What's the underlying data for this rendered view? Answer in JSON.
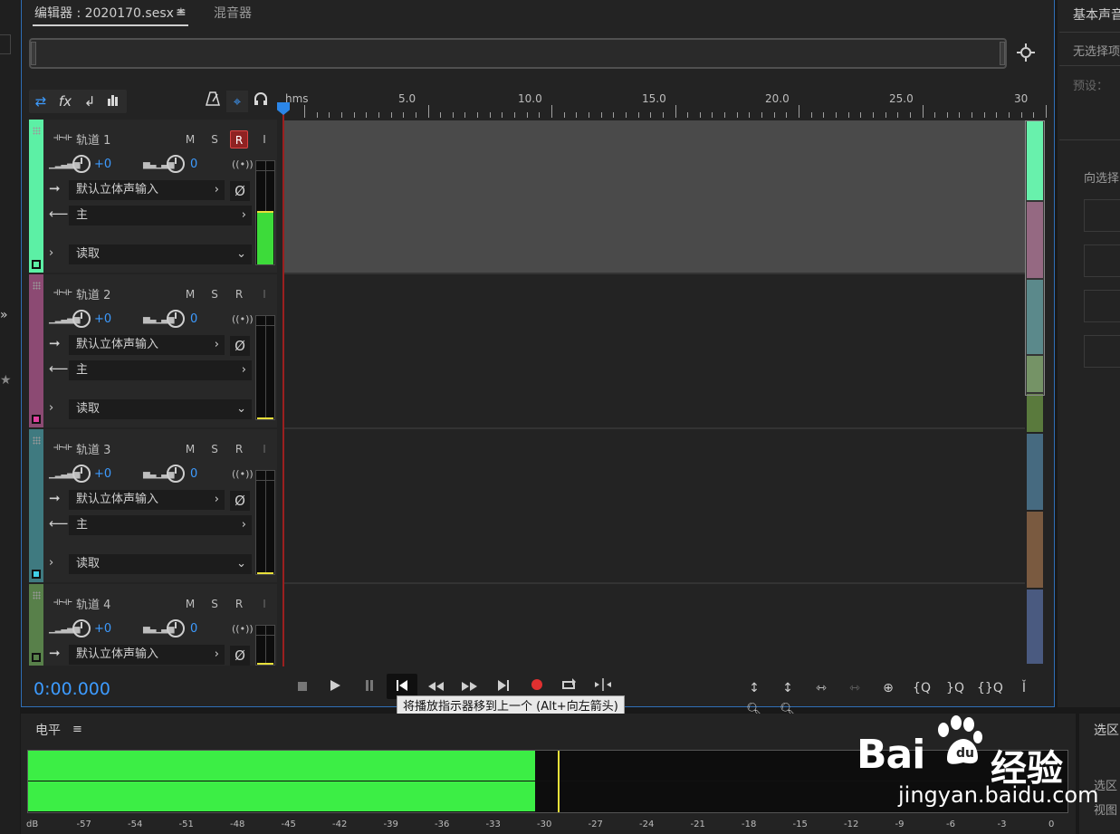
{
  "editor": {
    "tab_editor": "编辑器 : 2020170.sesx *",
    "tab_menu": "≡",
    "tab_mixer": "混音器"
  },
  "toolbar": {
    "icons": [
      "io-icon",
      "fx-icon",
      "send-icon",
      "eq-icon",
      "metronome-icon",
      "auto-icon",
      "headphones-icon"
    ]
  },
  "ruler": {
    "unit": "hms",
    "labels": [
      "5.0",
      "10.0",
      "15.0",
      "20.0",
      "25.0",
      "30"
    ]
  },
  "tracks": [
    {
      "name": "轨道 1",
      "m": "M",
      "s": "S",
      "r": "R",
      "i": "I",
      "volume": "+0",
      "pan": "0",
      "input": "默认立体声输入",
      "output": "主",
      "automation": "读取",
      "color": "#5cf0a5",
      "meter_level": 0.5
    },
    {
      "name": "轨道 2",
      "m": "M",
      "s": "S",
      "r": "R",
      "i": "I",
      "volume": "+0",
      "pan": "0",
      "input": "默认立体声输入",
      "output": "主",
      "automation": "读取",
      "color": "#8c4a73",
      "meter_level": 0.0
    },
    {
      "name": "轨道 3",
      "m": "M",
      "s": "S",
      "r": "R",
      "i": "I",
      "volume": "+0",
      "pan": "0",
      "input": "默认立体声输入",
      "output": "主",
      "automation": "读取",
      "color": "#3f7a80",
      "meter_level": 0.0
    },
    {
      "name": "轨道 4",
      "m": "M",
      "s": "S",
      "r": "R",
      "i": "I",
      "volume": "+0",
      "pan": "0",
      "input": "默认立体声输入",
      "output": "主",
      "automation": "读取",
      "color": "#58804a",
      "meter_level": 0.0
    }
  ],
  "transport": {
    "time": "0:00.000",
    "tooltip": "将播放指示器移到上一个 (Alt+向左箭头)"
  },
  "right_panel": {
    "title": "基本声音",
    "no_selection": "无选择项",
    "preset": "预设：",
    "assign": "向选择"
  },
  "level": {
    "title": "电平",
    "menu": "≡",
    "scale": [
      "dB",
      "-57",
      "-54",
      "-51",
      "-48",
      "-45",
      "-42",
      "-39",
      "-36",
      "-33",
      "-30",
      "-27",
      "-24",
      "-21",
      "-18",
      "-15",
      "-12",
      "-9",
      "-6",
      "-3",
      "0"
    ],
    "level_fraction": 0.488,
    "peak_fraction": 0.51
  },
  "selection_panel": {
    "title": "选区",
    "row1": "选区",
    "row2": "视图"
  },
  "watermark": {
    "logo": "Bai du",
    "cn": "经验",
    "url": "jingyan.baidu.com"
  }
}
